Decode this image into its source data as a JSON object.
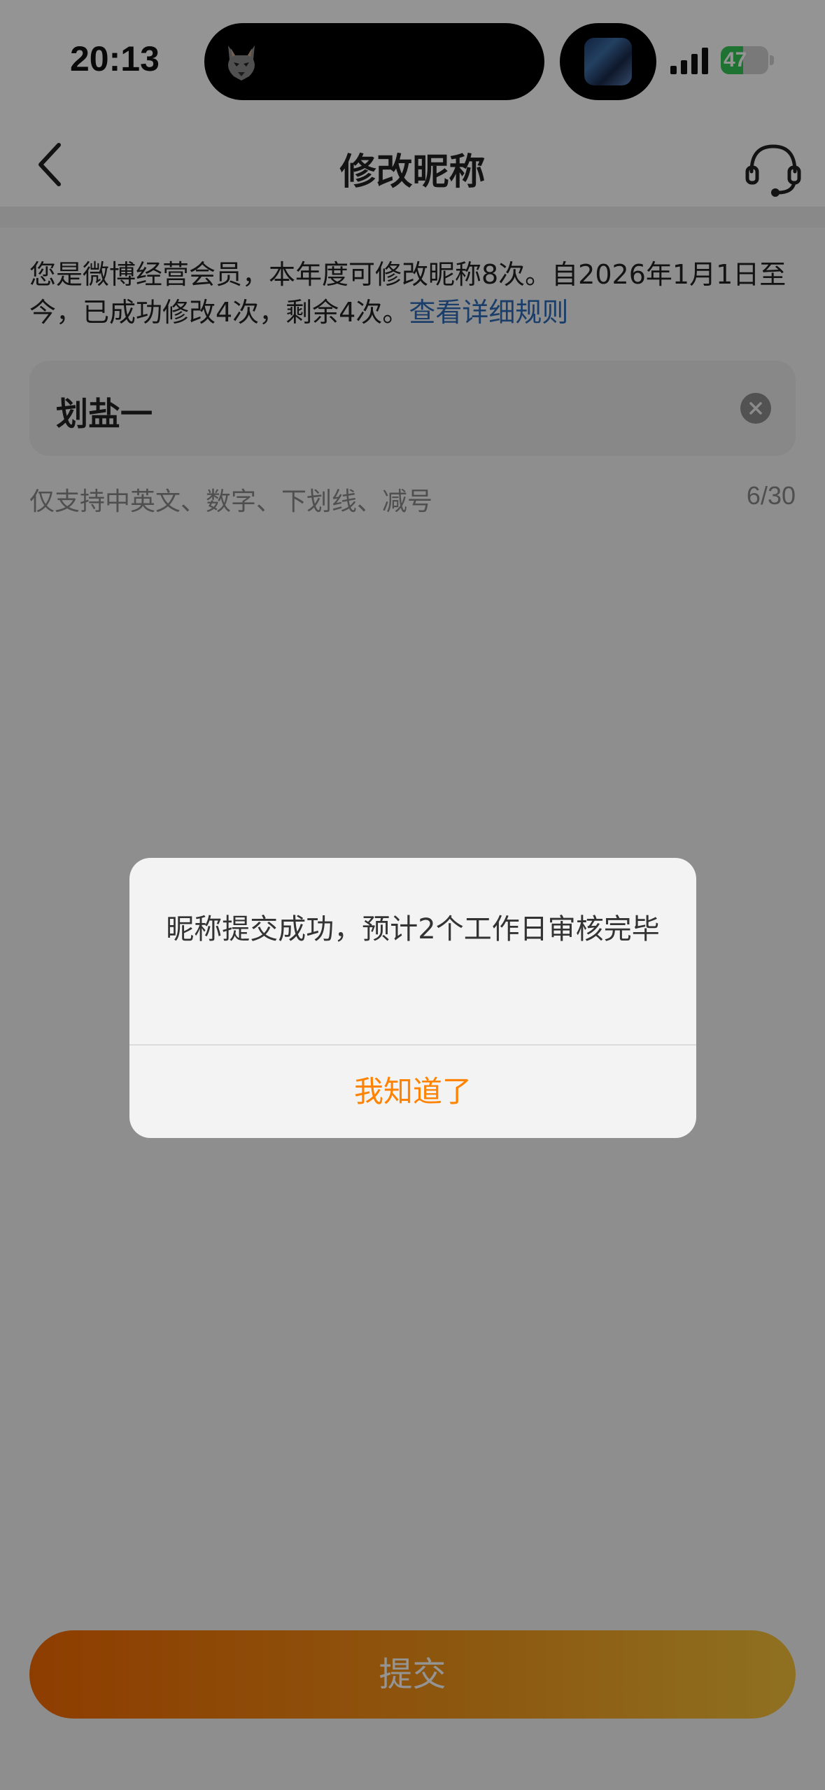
{
  "status_bar": {
    "time": "20:13",
    "battery_level": "47",
    "battery_fraction": 0.47
  },
  "nav": {
    "title": "修改昵称",
    "back_icon": "chevron-left-icon",
    "service_icon": "headset-icon"
  },
  "info": {
    "text": "您是微博经营会员，本年度可修改昵称8次。自2026年1月1日至今，已成功修改4次，剩余4次。",
    "link": "查看详细规则",
    "link_color": "#2d6cb5"
  },
  "nickname": {
    "value": "划盐一",
    "clear_icon": "clear-circle-icon"
  },
  "hint": {
    "text": "仅支持中英文、数字、下划线、减号",
    "count": "6/30"
  },
  "submit": {
    "label": "提交",
    "gradient_start": "#f56a00",
    "gradient_end": "#f6c23a"
  },
  "dialog": {
    "message": "昵称提交成功，预计2个工作日审核完毕",
    "confirm": "我知道了",
    "confirm_color": "#ff8200"
  }
}
